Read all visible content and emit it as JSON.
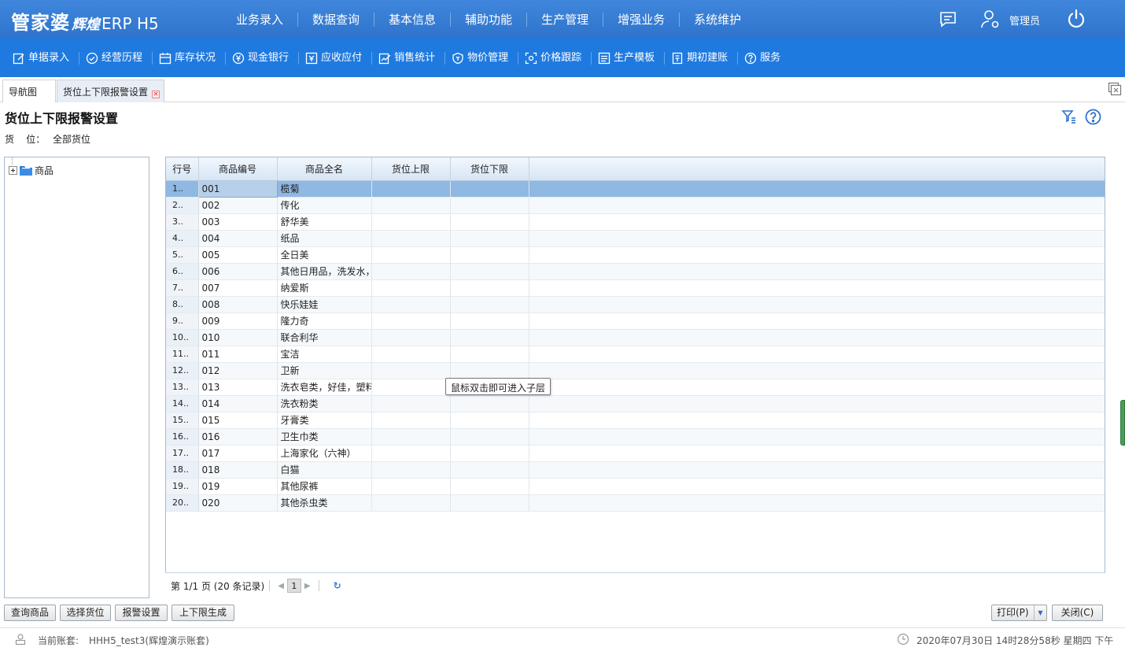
{
  "app": {
    "brand": "管家婆",
    "sub": "辉煌",
    "product": "ERP H5"
  },
  "main_menu": [
    "业务录入",
    "数据查询",
    "基本信息",
    "辅助功能",
    "生产管理",
    "增强业务",
    "系统维护"
  ],
  "user": {
    "name": "管理员"
  },
  "toolbar": [
    {
      "label": "单据录入",
      "icon": "edit-icon"
    },
    {
      "label": "经营历程",
      "icon": "check-circle-icon"
    },
    {
      "label": "库存状况",
      "icon": "calendar-icon"
    },
    {
      "label": "现金银行",
      "icon": "yen-icon"
    },
    {
      "label": "应收应付",
      "icon": "money-box-icon"
    },
    {
      "label": "销售统计",
      "icon": "chart-edit-icon"
    },
    {
      "label": "物价管理",
      "icon": "shield-icon"
    },
    {
      "label": "价格跟踪",
      "icon": "scan-icon"
    },
    {
      "label": "生产模板",
      "icon": "list-icon"
    },
    {
      "label": "期初建账",
      "icon": "book-icon"
    },
    {
      "label": "服务",
      "icon": "help-icon"
    }
  ],
  "tabs": [
    {
      "label": "导航图"
    },
    {
      "label": "货位上下限报警设置"
    }
  ],
  "page": {
    "title": "货位上下限报警设置",
    "location_label": "货    位：",
    "location_value": "全部货位"
  },
  "tree": {
    "root": "商品"
  },
  "grid": {
    "columns": [
      "行号",
      "商品编号",
      "商品全名",
      "货位上限",
      "货位下限"
    ],
    "rows": [
      {
        "no": "1..",
        "code": "001",
        "name": "榄菊",
        "upper": "",
        "lower": ""
      },
      {
        "no": "2..",
        "code": "002",
        "name": "传化",
        "upper": "",
        "lower": ""
      },
      {
        "no": "3..",
        "code": "003",
        "name": "舒华美",
        "upper": "",
        "lower": ""
      },
      {
        "no": "4..",
        "code": "004",
        "name": "纸品",
        "upper": "",
        "lower": ""
      },
      {
        "no": "5..",
        "code": "005",
        "name": "全日美",
        "upper": "",
        "lower": ""
      },
      {
        "no": "6..",
        "code": "006",
        "name": "其他日用品，洗发水，",
        "upper": "",
        "lower": ""
      },
      {
        "no": "7..",
        "code": "007",
        "name": "纳爱斯",
        "upper": "",
        "lower": ""
      },
      {
        "no": "8..",
        "code": "008",
        "name": "快乐娃娃",
        "upper": "",
        "lower": ""
      },
      {
        "no": "9..",
        "code": "009",
        "name": "隆力奇",
        "upper": "",
        "lower": ""
      },
      {
        "no": "10..",
        "code": "010",
        "name": "联合利华",
        "upper": "",
        "lower": ""
      },
      {
        "no": "11..",
        "code": "011",
        "name": "宝洁",
        "upper": "",
        "lower": ""
      },
      {
        "no": "12..",
        "code": "012",
        "name": "卫新",
        "upper": "",
        "lower": ""
      },
      {
        "no": "13..",
        "code": "013",
        "name": "洗衣皂类，好佳，塑料",
        "upper": "",
        "lower": ""
      },
      {
        "no": "14..",
        "code": "014",
        "name": "洗衣粉类",
        "upper": "",
        "lower": ""
      },
      {
        "no": "15..",
        "code": "015",
        "name": "牙膏类",
        "upper": "",
        "lower": ""
      },
      {
        "no": "16..",
        "code": "016",
        "name": "卫生巾类",
        "upper": "",
        "lower": ""
      },
      {
        "no": "17..",
        "code": "017",
        "name": "上海家化（六神）",
        "upper": "",
        "lower": ""
      },
      {
        "no": "18..",
        "code": "018",
        "name": "白猫",
        "upper": "",
        "lower": ""
      },
      {
        "no": "19..",
        "code": "019",
        "name": "其他尿裤",
        "upper": "",
        "lower": ""
      },
      {
        "no": "20..",
        "code": "020",
        "name": "其他杀虫类",
        "upper": "",
        "lower": ""
      }
    ],
    "selected_row": 0,
    "tooltip": "鼠标双击即可进入子层"
  },
  "pager": {
    "info": "第 1/1 页 (20 条记录)",
    "current_page": "1"
  },
  "buttons": {
    "query": "查询商品",
    "choose_location": "选择货位",
    "alarm_settings": "报警设置",
    "generate_limits": "上下限生成",
    "print": "打印(P)",
    "close": "关闭(C)"
  },
  "status": {
    "account_label": "当前账套:",
    "account_value": "HHH5_test3(辉煌演示账套)",
    "datetime": "2020年07月30日 14时28分58秒 星期四 下午"
  },
  "colors": {
    "topbar": "#3a80d8",
    "toolbar": "#1f7ae0",
    "selected_row": "#8fb8e2"
  }
}
